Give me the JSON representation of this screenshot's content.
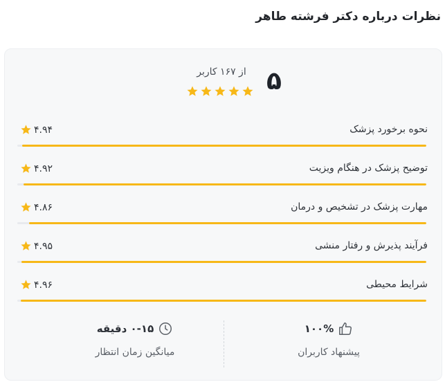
{
  "page": {
    "title": "نظرات درباره دکتر فرشته طاهر"
  },
  "summary": {
    "score": "۵",
    "users_text": "از ۱۶۷ کاربر",
    "stars_filled": 5,
    "star_color": "#f7b818"
  },
  "metrics": [
    {
      "label": "نحوه برخورد پزشک",
      "value": "۴.۹۴",
      "score": 4.94
    },
    {
      "label": "توضیح پزشک در هنگام ویزیت",
      "value": "۴.۹۲",
      "score": 4.92
    },
    {
      "label": "مهارت پزشک در تشخیص و درمان",
      "value": "۴.۸۶",
      "score": 4.86
    },
    {
      "label": "فرآیند پذیرش و رفتار منشی",
      "value": "۴.۹۵",
      "score": 4.95
    },
    {
      "label": "شرایط محیطی",
      "value": "۴.۹۶",
      "score": 4.96
    }
  ],
  "stats": {
    "recommend": {
      "value": "۱۰۰%",
      "label": "پیشنهاد کاربران",
      "icon": "thumbs-up-icon"
    },
    "wait": {
      "value": "۰-۱۵ دقیقه",
      "label": "میانگین زمان انتظار",
      "icon": "clock-icon"
    }
  },
  "colors": {
    "accent": "#f7b818",
    "track": "#e8eaee",
    "card_bg": "#f7f8f9"
  }
}
